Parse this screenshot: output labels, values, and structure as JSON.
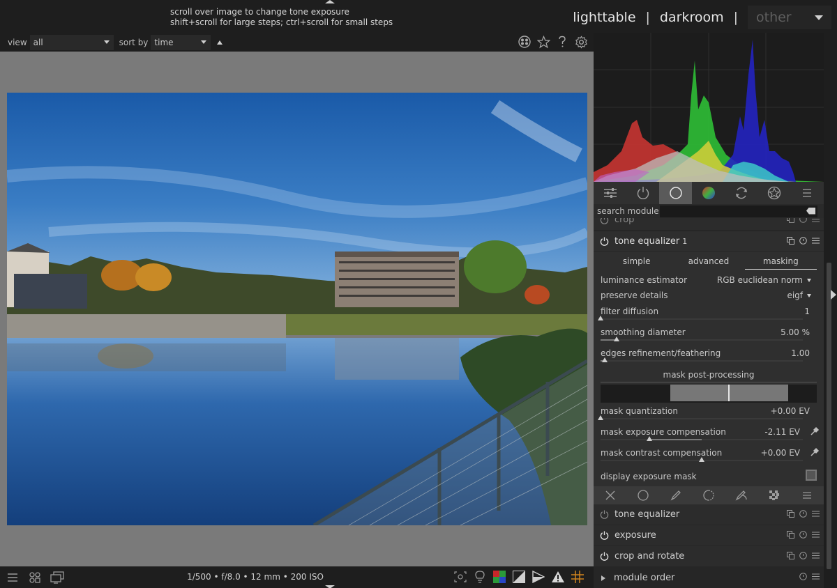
{
  "topbar": {
    "hint_line1": "scroll over image to change tone exposure",
    "hint_line2": "shift+scroll for large steps; ctrl+scroll for small steps",
    "views": {
      "lighttable": "lighttable",
      "sep": "|",
      "darkroom": "darkroom",
      "other": "other"
    }
  },
  "filterbar": {
    "view_label": "view",
    "view_value": "all",
    "sort_label": "sort by",
    "sort_value": "time",
    "icons": [
      "color-labels-icon",
      "star-icon",
      "help-icon",
      "preferences-gear-icon"
    ]
  },
  "bottombar": {
    "exif": "1/500 • f/8.0 • 12 mm • 200 ISO",
    "left_icons": [
      "menu-icon",
      "styles-icon",
      "second-window-icon"
    ],
    "right_icons": [
      "focus-peaking-icon",
      "color-assessment-bulb-icon",
      "raw-overexposed-icon",
      "clipping-icon",
      "softproof-icon",
      "gamut-check-icon",
      "guides-icon"
    ]
  },
  "panel": {
    "tabs": [
      "quick-access-icon",
      "active-modules-icon",
      "base-modules-icon",
      "color-modules-icon",
      "correction-modules-icon",
      "effects-modules-icon",
      "presets-menu-icon"
    ],
    "active_tab": 2,
    "search_label": "search module",
    "search_value": "",
    "modules": {
      "crop_partial": "crop",
      "tone_equalizer": {
        "name": "tone equalizer",
        "instance": "1",
        "subtabs": [
          "simple",
          "advanced",
          "masking"
        ],
        "active_subtab": "masking",
        "luminance_estimator_label": "luminance estimator",
        "luminance_estimator_value": "RGB euclidean norm",
        "preserve_details_label": "preserve details",
        "preserve_details_value": "eigf",
        "filter_diffusion_label": "filter diffusion",
        "filter_diffusion_value": "1",
        "filter_diffusion_level": 0.0,
        "smoothing_diameter_label": "smoothing diameter",
        "smoothing_diameter_value": "5.00 %",
        "smoothing_diameter_level": 0.08,
        "edges_label": "edges refinement/feathering",
        "edges_value": "1.00",
        "edges_level": 0.02,
        "mask_pp_title": "mask post-processing",
        "mask_quantization_label": "mask quantization",
        "mask_quantization_value": "+0.00 EV",
        "mask_quantization_level": 0.0,
        "mask_exp_comp_label": "mask exposure compensation",
        "mask_exp_comp_value": "-2.11 EV",
        "mask_exp_comp_level": 0.24,
        "mask_contrast_label": "mask contrast compensation",
        "mask_contrast_value": "+0.00 EV",
        "mask_contrast_level": 0.5,
        "display_mask_label": "display exposure mask",
        "blend_icons": [
          "blend-off-icon",
          "uniform-blend-icon",
          "drawn-mask-icon",
          "parametric-mask-icon",
          "drawn-parametric-mask-icon",
          "raster-mask-icon",
          "blend-menu-icon"
        ]
      },
      "list": [
        "tone equalizer",
        "exposure",
        "crop and rotate"
      ],
      "module_order": "module order"
    }
  },
  "histogram": {
    "channels": [
      "red",
      "green",
      "blue"
    ],
    "colors": {
      "red": "#d23a36",
      "green": "#36c038",
      "blue": "#2828c8"
    }
  }
}
